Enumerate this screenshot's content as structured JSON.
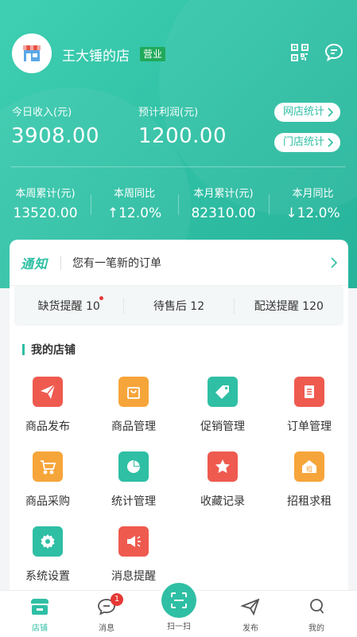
{
  "header": {
    "shop_name": "王大锤的店",
    "status": "营业",
    "qr_icon": "qrcode-icon",
    "message_icon": "chat-icon"
  },
  "stats": {
    "today_income_label": "今日收入(元)",
    "today_income_value": "3908.00",
    "expected_profit_label": "预计利润(元)",
    "expected_profit_value": "1200.00",
    "online_stats_label": "网店统计",
    "store_stats_label": "门店统计",
    "week_total_label": "本周累计(元)",
    "week_total_value": "13520.00",
    "week_yoy_label": "本周同比",
    "week_yoy_value": "↑12.0%",
    "month_total_label": "本月累计(元)",
    "month_total_value": "82310.00",
    "month_yoy_label": "本月同比",
    "month_yoy_value": "↓12.0%"
  },
  "notice": {
    "tag": "通知",
    "text": "您有一笔新的订单"
  },
  "reminders": [
    {
      "label": "缺货提醒 10"
    },
    {
      "label": "待售后 12"
    },
    {
      "label": "配送提醒 120"
    }
  ],
  "section": {
    "title": "我的店铺"
  },
  "grid": [
    {
      "label": "商品发布",
      "icon": "paper-plane-icon",
      "color": "#ef5a4f"
    },
    {
      "label": "商品管理",
      "icon": "shopping-bag-icon",
      "color": "#f6a53a"
    },
    {
      "label": "促销管理",
      "icon": "tag-icon",
      "color": "#2fbfa4"
    },
    {
      "label": "订单管理",
      "icon": "document-icon",
      "color": "#ef5a4f"
    },
    {
      "label": "商品采购",
      "icon": "cart-icon",
      "color": "#f6a53a"
    },
    {
      "label": "统计管理",
      "icon": "pie-chart-icon",
      "color": "#2fbfa4"
    },
    {
      "label": "收藏记录",
      "icon": "star-icon",
      "color": "#ef5a4f"
    },
    {
      "label": "招租求租",
      "icon": "rent-house-icon",
      "color": "#f6a53a"
    },
    {
      "label": "系统设置",
      "icon": "gear-icon",
      "color": "#2fbfa4"
    },
    {
      "label": "消息提醒",
      "icon": "megaphone-icon",
      "color": "#ef5a4f"
    }
  ],
  "tabbar": {
    "shop": "店铺",
    "messages": "消息",
    "messages_badge": "1",
    "scan": "扫一扫",
    "publish": "发布",
    "mine": "我的"
  }
}
